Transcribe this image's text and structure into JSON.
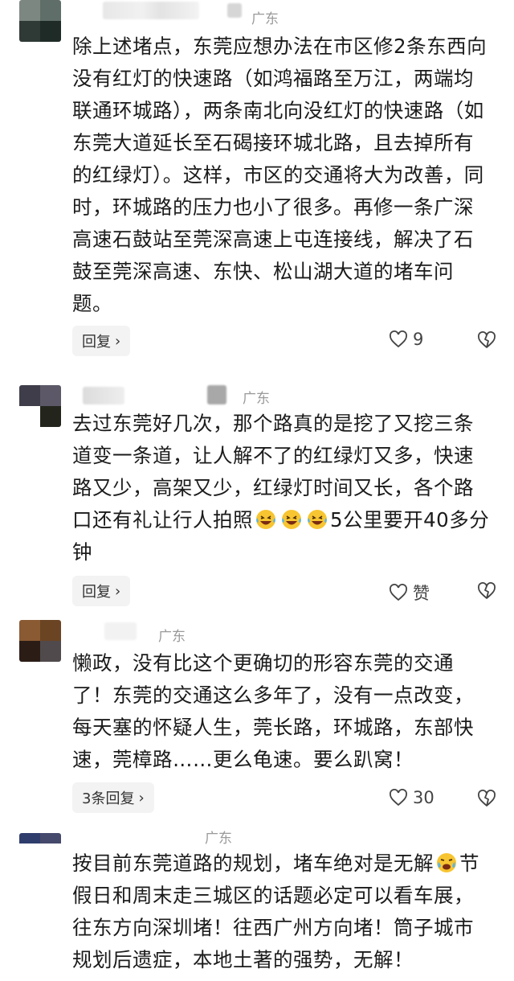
{
  "comments": [
    {
      "region": "广东",
      "text": "除上述堵点，东莞应想办法在市区修2条东西向没有红灯的快速路（如鸿福路至万江，两端均联通环城路），两条南北向没红灯的快速路（如东莞大道延长至石碣接环城北路，且去掉所有的红绿灯）。这样，市区的交通将大为改善，同时，环城路的压力也小了很多。再修一条广深高速石鼓站至莞深高速上屯连接线，解决了石鼓至莞深高速、东快、松山湖大道的堵车问题。",
      "reply_label": "回复",
      "like_count": "9"
    },
    {
      "region": "广东",
      "text_part1": "去过东莞好几次，那个路真的是挖了又挖三条道变一条道，让人解不了的红绿灯又多，快速路又少，高架又少，红绿灯时间又长，各个路口还有礼让行人拍照",
      "text_part2": "5公里要开40多分钟",
      "emoji_icon": "laughing-tears-emoji",
      "reply_label": "回复",
      "like_label": "赞"
    },
    {
      "region": "广东",
      "text": "懒政，没有比这个更确切的形容东莞的交通了！东莞的交通这么多年了，没有一点改变，每天塞的怀疑人生，莞长路，环城路，东部快速，莞樟路……更么龟速。要么趴窝！",
      "reply_label": "3条回复",
      "like_count": "30"
    },
    {
      "region": "广东",
      "text_part1": "按目前东莞道路的规划，堵车绝对是无解",
      "text_part2": "节假日和周末走三城区的话题必定可以看车展，往东方向深圳堵！往西广州方向堵！筒子城市规划后遗症，本地土著的强势，无解！",
      "emoji_icon": "crying-laughing-emoji"
    }
  ],
  "icons": {
    "like": "heart-outline-icon",
    "dislike": "broken-heart-icon",
    "chevron": "chevron-right-icon"
  },
  "colors": {
    "text": "#1b1b1b",
    "meta": "#9a9a9a",
    "button_bg": "#f3f3f3",
    "emoji_face": "#f7c531"
  }
}
